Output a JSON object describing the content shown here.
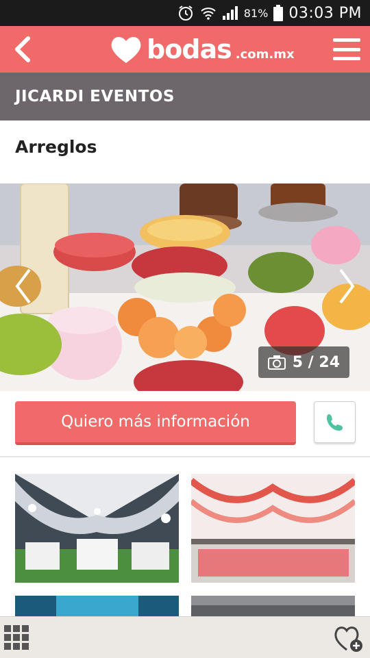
{
  "status_bar": {
    "battery": "81%",
    "time": "03:03 PM"
  },
  "app_bar": {
    "logo_text": "bodas",
    "logo_suffix": ".com.mx"
  },
  "vendor": {
    "name": "JICARDI EVENTOS"
  },
  "section": {
    "title": "Arreglos"
  },
  "gallery": {
    "counter": "5 / 24"
  },
  "actions": {
    "cta_label": "Quiero más información"
  },
  "colors": {
    "brand": "#f06a6a",
    "vendor_bar": "#6d676b",
    "call_icon": "#4fc3a1"
  },
  "icons": [
    "back-icon",
    "heart-logo-icon",
    "menu-icon",
    "camera-icon",
    "chevron-left-icon",
    "chevron-right-icon",
    "phone-icon",
    "grid-icon",
    "heart-plus-icon",
    "alarm-icon",
    "wifi-icon",
    "signal-icon",
    "battery-icon"
  ]
}
